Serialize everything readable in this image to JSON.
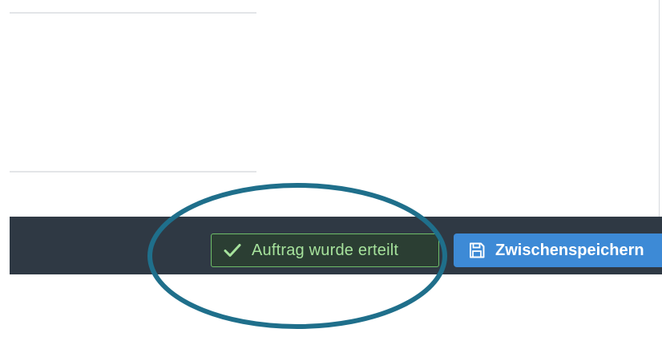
{
  "footer": {
    "status_label": "Auftrag wurde erteilt",
    "save_label": "Zwischenspeichern"
  },
  "icons": {
    "status": "check-icon",
    "save": "floppy-disk-icon"
  },
  "colors": {
    "toolbar_background": "#2f3944",
    "status_green": "#a6e29c",
    "status_border": "#6fbe6a",
    "save_button_blue": "#3d8ad6",
    "highlight_ellipse": "#1f6f8b"
  }
}
